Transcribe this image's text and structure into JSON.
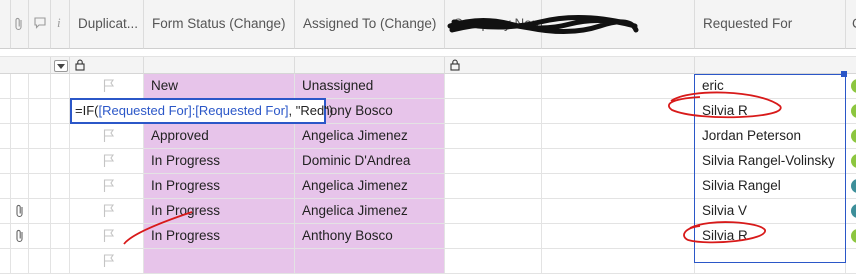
{
  "columns": {
    "duplicate": "Duplicat...",
    "form_status": "Form Status (Change)",
    "assigned_to": "Assigned To (Change)",
    "company_name": "Company Name",
    "requested_for": "Requested For",
    "last": "C"
  },
  "info_icon_text": "i",
  "formula": {
    "prefix": "=IF(",
    "ref1": "[Requested For]:[Requested For]",
    "middle": ", ",
    "value": "\"Red\"",
    "suffix": ")"
  },
  "rows": [
    {
      "attachment": false,
      "status": "New",
      "assigned": "Unassigned",
      "requested": "eric",
      "status_color": "#8cc63f"
    },
    {
      "attachment": false,
      "status": "",
      "assigned": "Anthony Bosco",
      "requested": "Silvia R",
      "status_color": "#8cc63f"
    },
    {
      "attachment": false,
      "status": "Approved",
      "assigned": "Angelica Jimenez",
      "requested": "Jordan Peterson",
      "status_color": "#8cc63f"
    },
    {
      "attachment": false,
      "status": "In Progress",
      "assigned": "Dominic D'Andrea",
      "requested": "Silvia Rangel-Volinsky",
      "status_color": "#8cc63f"
    },
    {
      "attachment": false,
      "status": "In Progress",
      "assigned": "Angelica Jimenez",
      "requested": "Silvia Rangel",
      "status_color": "#3d8f9a"
    },
    {
      "attachment": true,
      "status": "In Progress",
      "assigned": "Angelica Jimenez",
      "requested": "Silvia V",
      "status_color": "#3d8f9a"
    },
    {
      "attachment": true,
      "status": "In Progress",
      "assigned": "Anthony Bosco",
      "requested": "Silvia R",
      "status_color": "#8cc63f"
    },
    {
      "attachment": false,
      "status": "",
      "assigned": "",
      "requested": "",
      "status_color": ""
    }
  ],
  "colors": {
    "highlight_purple": "#e7c4ea",
    "selection_blue": "#2b57c8",
    "formula_ref_blue": "#2b57c8",
    "annotation_red": "#d81a1a"
  }
}
